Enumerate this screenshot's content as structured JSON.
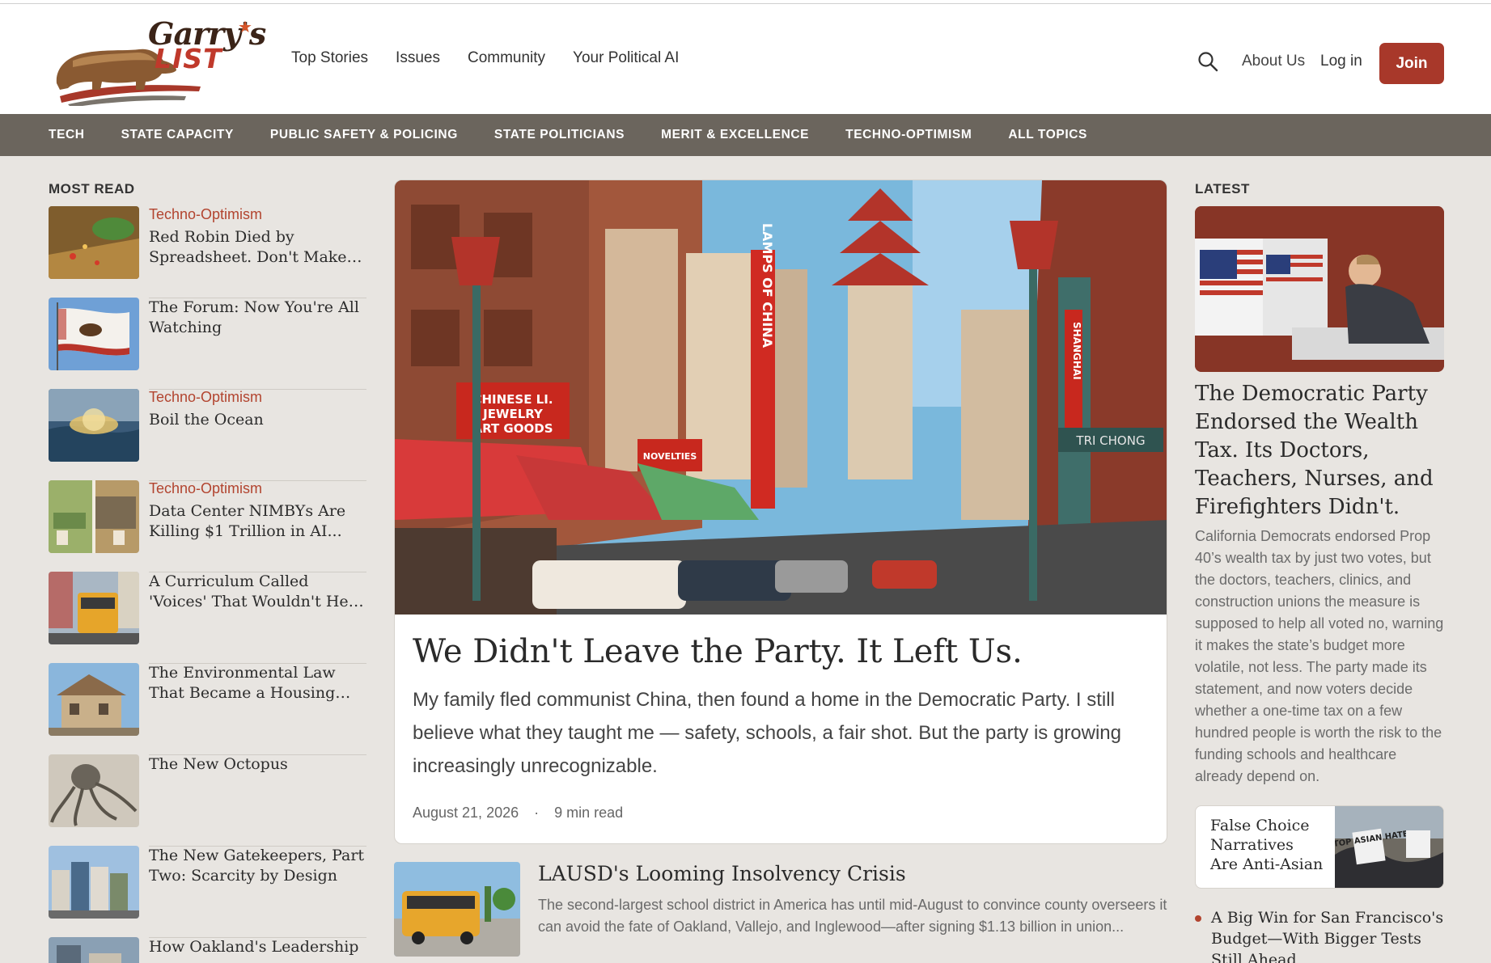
{
  "brand": {
    "line1": "Garry's",
    "line2": "LIST"
  },
  "nav": {
    "items": [
      "Top Stories",
      "Issues",
      "Community",
      "Your Political AI"
    ]
  },
  "header": {
    "about": "About Us",
    "login": "Log in",
    "join": "Join"
  },
  "topics": [
    "TECH",
    "STATE CAPACITY",
    "PUBLIC SAFETY & POLICING",
    "STATE POLITICIANS",
    "MERIT & EXCELLENCE",
    "TECHNO-OPTIMISM",
    "ALL TOPICS"
  ],
  "most_read": {
    "label": "MOST READ",
    "items": [
      {
        "category": "Techno-Optimism",
        "title": "Red Robin Died by Spreadsheet. Don't Make th..."
      },
      {
        "category": "",
        "title": "The Forum: Now You're All Watching"
      },
      {
        "category": "Techno-Optimism",
        "title": "Boil the Ocean"
      },
      {
        "category": "Techno-Optimism",
        "title": "Data Center NIMBYs Are Killing $1 Trillion in AI..."
      },
      {
        "category": "",
        "title": "A Curriculum Called 'Voices' That Wouldn't Hear Ours"
      },
      {
        "category": "",
        "title": "The Environmental Law That Became a Housing Veto"
      },
      {
        "category": "",
        "title": "The New Octopus"
      },
      {
        "category": "",
        "title": "The New Gatekeepers, Part Two: Scarcity by Design"
      },
      {
        "category": "",
        "title": "How Oakland's Leadership"
      }
    ]
  },
  "hero": {
    "title": "We Didn't Leave the Party. It Left Us.",
    "description": "My family fled communist China, then found a home in the Democratic Party. I still believe what they taught me — safety, schools, a fair shot. But the party is growing increasingly unrecognizable.",
    "date": "August 21, 2026",
    "separator": "·",
    "read_time": "9 min read",
    "image_signs": [
      "CHINESE LI.",
      "JEWELRY",
      "ART GOODS",
      "LAMPS OF CHINA",
      "SHANGHAI",
      "TRI CHONG",
      "NOVELTIES"
    ]
  },
  "sub_story": {
    "title": "LAUSD's Looming Insolvency Crisis",
    "description": "The second-largest school district in America has until mid-August to convince county overseers it can avoid the fate of Oakland, Vallejo, and Inglewood—after signing $1.13 billion in union..."
  },
  "latest": {
    "label": "LATEST",
    "title": "The Democratic Party Endorsed the Wealth Tax. Its Doctors, Teachers, Nurses, and Firefighters Didn't.",
    "description": "California Democrats endorsed Prop 40’s wealth tax by just two votes, but the doctors, teachers, clinics, and construction unions the measure is supposed to help all voted no, warning it makes the state’s budget more volatile, not less. The party made its statement, and now voters decide whether a one-time tax on a few hundred people is worth the risk to the funding schools and healthcare already depend on.",
    "card_title": "False Choice Narratives Are Anti-Asian",
    "card_image_sign": "STOP ASIAN HATE",
    "bullet_title": "A Big Win for San Francisco's Budget—With Bigger Tests Still Ahead"
  },
  "colors": {
    "accent": "#a8382a",
    "topic_bar": "#6b655d",
    "category": "#b2442f",
    "background": "#e8e5e1"
  }
}
